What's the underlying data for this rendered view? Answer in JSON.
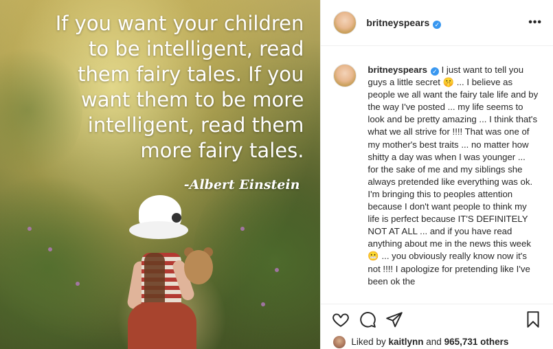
{
  "image": {
    "quote_lines": [
      "If you want your children",
      "to be intelligent, read",
      "them fairy tales. If you",
      "want them to be more",
      "intelligent, read them",
      "more fairy tales."
    ],
    "signature": "-Albert Einstein"
  },
  "header": {
    "username": "britneyspears",
    "verified": "✓",
    "more": "•••"
  },
  "caption": {
    "username": "britneyspears",
    "text": "I just want to tell you guys a little secret 🤫 ... I believe as people we all want the fairy tale life and by the way I've posted ... my life seems to look and be pretty amazing ... I think that's what we all strive for !!!! That was one of my mother's best traits ... no matter how shitty a day was when I was younger ... for the sake of me and my siblings she always pretended like everything was ok. I'm bringing this to peoples attention because I don't want people to think my life is perfect because IT'S DEFINITELY NOT AT ALL ... and if you have read anything about me in the news this week 😬 ... you obviously really know now it's not !!!! I apologize for pretending like I've been ok the"
  },
  "actions": {
    "icons": [
      "heart-icon",
      "comment-icon",
      "share-icon",
      "bookmark-icon"
    ]
  },
  "likes": {
    "prefix": "Liked by",
    "user": "kaitlynn",
    "and": "and",
    "others": "965,731 others"
  }
}
